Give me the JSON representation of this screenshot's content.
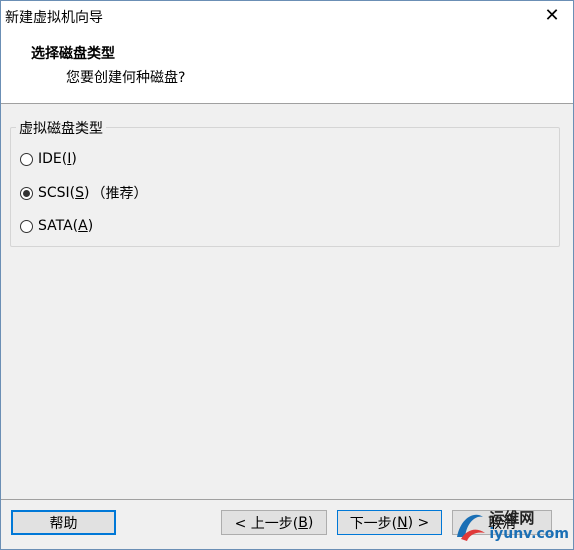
{
  "window": {
    "title": "新建虚拟机向导"
  },
  "header": {
    "title": "选择磁盘类型",
    "subtitle": "您要创建何种磁盘?"
  },
  "disk_type": {
    "legend": "虚拟磁盘类型",
    "options": [
      {
        "label_prefix": "IDE(",
        "mnemonic": "I",
        "label_suffix": ")",
        "note": "",
        "selected": false
      },
      {
        "label_prefix": "SCSI(",
        "mnemonic": "S",
        "label_suffix": ")",
        "note": "（推荐）",
        "selected": true
      },
      {
        "label_prefix": "SATA(",
        "mnemonic": "A",
        "label_suffix": ")",
        "note": "",
        "selected": false
      }
    ]
  },
  "buttons": {
    "help": "帮助",
    "back_prefix": "< 上一步(",
    "back_mnemonic": "B",
    "back_suffix": ")",
    "next_prefix": "下一步(",
    "next_mnemonic": "N",
    "next_suffix": ") >",
    "cancel": "取消"
  },
  "watermark": {
    "cn": "运维网",
    "en": "iyunv.com"
  },
  "colors": {
    "accent": "#0078d7",
    "frame": "#6b8fb5",
    "dialog_bg": "#f0f0f0"
  }
}
